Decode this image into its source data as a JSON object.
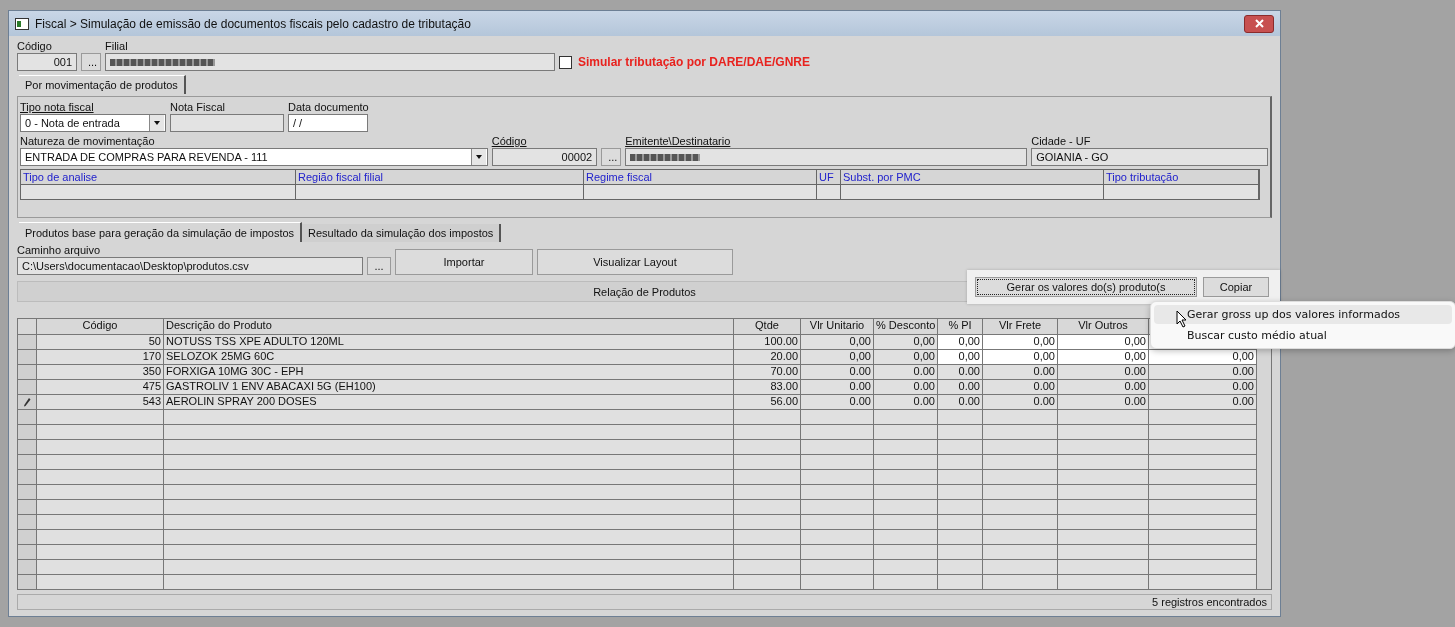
{
  "window": {
    "title": "Fiscal > Simulação de emissão de documentos fiscais pelo cadastro de tributação"
  },
  "header": {
    "codigo_label": "Código",
    "codigo_value": "001",
    "lookup_button": "...",
    "filial_label": "Filial",
    "simular": {
      "label": "Simular tributação por DARE/DAE/GNRE",
      "checked": false
    }
  },
  "top_tabs": [
    {
      "label": "Por movimentação de produtos",
      "selected": true
    }
  ],
  "document": {
    "tipo_label": "Tipo nota fiscal",
    "tipo_value": "0 - Nota de entrada",
    "nota_label": "Nota Fiscal",
    "data_label": "Data documento",
    "data_value": "/ /",
    "natureza_label": "Natureza de movimentação",
    "natureza_value": "ENTRADA DE COMPRAS PARA REVENDA - 111",
    "codigo_label": "Código",
    "codigo_value": "00002",
    "lookup_button": "...",
    "emitente_label": "Emitente\\Destinatario",
    "cidade_label": "Cidade - UF",
    "cidade_value": "GOIANIA - GO"
  },
  "analysis_columns": [
    "Tipo de analise",
    "Região fiscal filial",
    "Regime fiscal",
    "UF",
    "Subst. por PMC",
    "Tipo tributação"
  ],
  "bottom_tabs": [
    {
      "label": "Produtos base para geração da simulação de impostos",
      "selected": true
    },
    {
      "label": "Resultado da simulação dos impostos",
      "selected": false
    }
  ],
  "file": {
    "label": "Caminho arquivo",
    "value": "C:\\Users\\documentacao\\Desktop\\produtos.csv",
    "browse_button": "...",
    "import_button": "Importar",
    "layout_button": "Visualizar Layout"
  },
  "products_title": "Relação de Produtos",
  "table": {
    "columns": [
      "Código",
      "Descrição do Produto",
      "Qtde",
      "Vlr Unitario",
      "% Desconto",
      "% PI",
      "Vlr Frete",
      "Vlr Outros"
    ],
    "rows": [
      {
        "editing": false,
        "highlight": true,
        "cells": [
          "50",
          "NOTUSS TSS XPE ADULTO 120ML",
          "100.00",
          "0,00",
          "0,00",
          "0,00",
          "0,00",
          "0,00"
        ]
      },
      {
        "editing": false,
        "highlight": true,
        "cells": [
          "170",
          "SELOZOK 25MG 60C",
          "20.00",
          "0,00",
          "0,00",
          "0,00",
          "0,00",
          "0,00",
          "0,00"
        ]
      },
      {
        "editing": false,
        "highlight": false,
        "cells": [
          "350",
          "FORXIGA 10MG 30C - EPH",
          "70.00",
          "0.00",
          "0.00",
          "0.00",
          "0.00",
          "0.00",
          "0.00"
        ]
      },
      {
        "editing": false,
        "highlight": false,
        "cells": [
          "475",
          "GASTROLIV 1 ENV ABACAXI 5G (EH100)",
          "83.00",
          "0.00",
          "0.00",
          "0.00",
          "0.00",
          "0.00",
          "0.00"
        ]
      },
      {
        "editing": true,
        "highlight": false,
        "cells": [
          "543",
          "AEROLIN SPRAY 200 DOSES",
          "56.00",
          "0.00",
          "0.00",
          "0.00",
          "0.00",
          "0.00",
          "0.00"
        ]
      }
    ]
  },
  "status": "5 registros encontrados",
  "popup": {
    "generate_button": "Gerar os valores do(s) produto(s",
    "copy_button": "Copiar"
  },
  "context_menu": [
    {
      "label": "Gerar gross up dos valores informados",
      "selected": true
    },
    {
      "label": "Buscar custo médio atual",
      "selected": false
    }
  ]
}
